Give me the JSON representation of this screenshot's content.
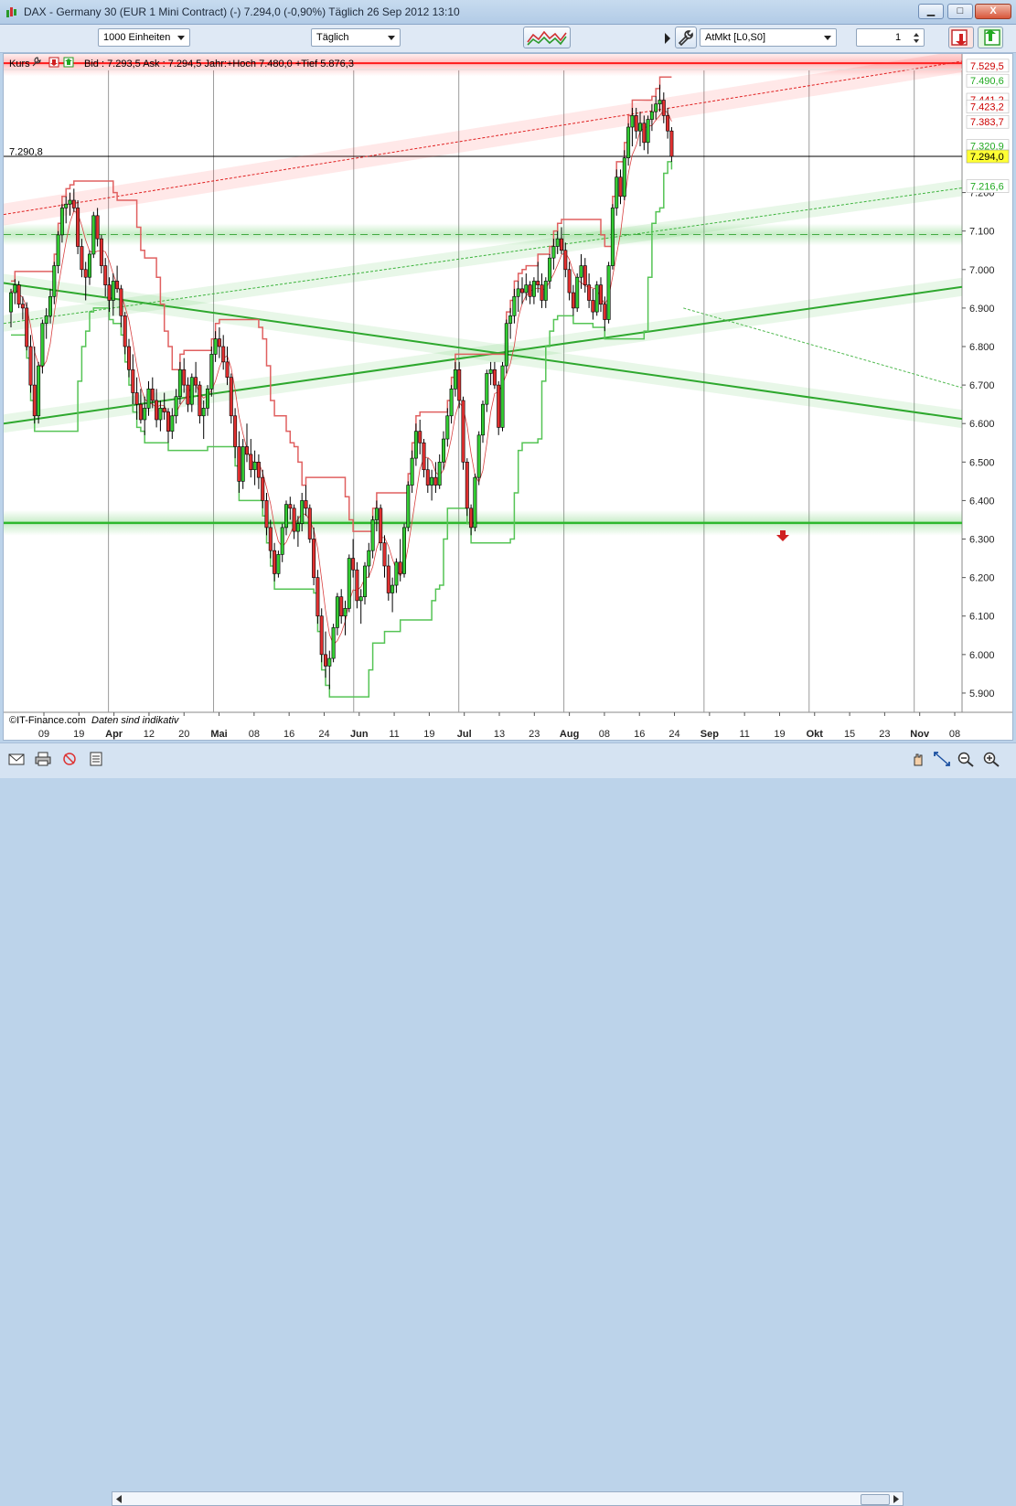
{
  "window": {
    "title": "DAX - Germany 30 (EUR 1 Mini Contract) (-)   7.294,0 (-0,90%)   Täglich  26 Sep 2012 13:10",
    "minimize": "▁",
    "maximize": "□",
    "close": "X"
  },
  "toolbar": {
    "units_select": "1000 Einheiten",
    "interval_select": "Täglich",
    "order_type_select": "AtMkt [L0,S0]",
    "quantity_value": "1"
  },
  "chart_header": {
    "label": "Kurs",
    "bid_ask_text": "Bid : 7.293,5 Ask : 7.294,5 Jahr:+Hoch 7.480,0 +Tief 5.876,3"
  },
  "footer": {
    "copyright": "©IT-Finance.com",
    "disclaimer": "Daten sind indikativ"
  },
  "colors": {
    "up": "#33cc33",
    "down": "#e03030",
    "resistance": "#ff1a1a",
    "support": "#2db82d",
    "price_tag": "#ffff33"
  },
  "chart_data": {
    "type": "candlestick",
    "ylim": [
      5850,
      7560
    ],
    "y_ticks": [
      "5.900",
      "6.000",
      "6.100",
      "6.200",
      "6.300",
      "6.400",
      "6.500",
      "6.600",
      "6.700",
      "6.800",
      "6.900",
      "7.000",
      "7.100",
      "7.200"
    ],
    "x_ticks": [
      "09",
      "19",
      "Apr",
      "12",
      "20",
      "Mai",
      "08",
      "16",
      "24",
      "Jun",
      "11",
      "19",
      "Jul",
      "13",
      "23",
      "Aug",
      "08",
      "16",
      "24",
      "Sep",
      "11",
      "19",
      "Okt",
      "15",
      "23",
      "Nov",
      "08"
    ],
    "month_ticks": [
      "Apr",
      "Mai",
      "Jun",
      "Jul",
      "Aug",
      "Sep",
      "Okt",
      "Nov"
    ],
    "crosshair_value": "7.290,8",
    "price_labels": [
      {
        "text": "7.529,5",
        "value": 7529.5,
        "color": "#cc0000"
      },
      {
        "text": "7.490,6",
        "value": 7490.6,
        "color": "#22aa22"
      },
      {
        "text": "7.441,2",
        "value": 7441.2,
        "color": "#cc0000"
      },
      {
        "text": "7.423,2",
        "value": 7423.2,
        "color": "#cc0000"
      },
      {
        "text": "7.383,7",
        "value": 7383.7,
        "color": "#cc0000"
      },
      {
        "text": "7.320,9",
        "value": 7320.9,
        "color": "#22aa22"
      },
      {
        "text": "7.294,0",
        "value": 7294.0,
        "color": "#000000"
      },
      {
        "text": "7.216,6",
        "value": 7216.6,
        "color": "#22aa22"
      }
    ],
    "horizontal_levels": [
      {
        "value": 7536,
        "style": "resistance"
      },
      {
        "value": 7294,
        "style": "price"
      },
      {
        "value": 7091,
        "style": "dashed-support"
      },
      {
        "value": 6342,
        "style": "support"
      }
    ],
    "trend_lines": [
      {
        "from": [
          0,
          7143
        ],
        "to": [
          254,
          7541
        ],
        "style": "dotted-red"
      },
      {
        "from": [
          0,
          6600
        ],
        "to": [
          254,
          6955
        ],
        "style": "support"
      },
      {
        "from": [
          0,
          6965
        ],
        "to": [
          254,
          6612
        ],
        "style": "support"
      },
      {
        "from": [
          0,
          6860
        ],
        "to": [
          254,
          7212
        ],
        "style": "dotted-green"
      },
      {
        "from": [
          171,
          6900
        ],
        "to": [
          254,
          6693
        ],
        "style": "dotted-green-thin"
      }
    ],
    "candles": [
      {
        "o": 6890,
        "h": 6950,
        "l": 6850,
        "c": 6940
      },
      {
        "o": 6940,
        "h": 6975,
        "l": 6910,
        "c": 6960
      },
      {
        "o": 6960,
        "h": 6970,
        "l": 6900,
        "c": 6910
      },
      {
        "o": 6910,
        "h": 6930,
        "l": 6870,
        "c": 6900
      },
      {
        "o": 6900,
        "h": 6915,
        "l": 6790,
        "c": 6800
      },
      {
        "o": 6800,
        "h": 6830,
        "l": 6680,
        "c": 6700
      },
      {
        "o": 6700,
        "h": 6800,
        "l": 6600,
        "c": 6620
      },
      {
        "o": 6620,
        "h": 6760,
        "l": 6600,
        "c": 6750
      },
      {
        "o": 6750,
        "h": 6870,
        "l": 6730,
        "c": 6860
      },
      {
        "o": 6860,
        "h": 6900,
        "l": 6820,
        "c": 6880
      },
      {
        "o": 6880,
        "h": 6950,
        "l": 6860,
        "c": 6930
      },
      {
        "o": 6930,
        "h": 7020,
        "l": 6910,
        "c": 7010
      },
      {
        "o": 7010,
        "h": 7100,
        "l": 6990,
        "c": 7090
      },
      {
        "o": 7090,
        "h": 7170,
        "l": 7070,
        "c": 7160
      },
      {
        "o": 7160,
        "h": 7190,
        "l": 7120,
        "c": 7170
      },
      {
        "o": 7170,
        "h": 7200,
        "l": 7140,
        "c": 7180
      },
      {
        "o": 7180,
        "h": 7210,
        "l": 7150,
        "c": 7160
      },
      {
        "o": 7160,
        "h": 7180,
        "l": 7040,
        "c": 7060
      },
      {
        "o": 7060,
        "h": 7080,
        "l": 6980,
        "c": 7000
      },
      {
        "o": 7000,
        "h": 7020,
        "l": 6920,
        "c": 6980
      },
      {
        "o": 6980,
        "h": 7050,
        "l": 6960,
        "c": 7040
      },
      {
        "o": 7040,
        "h": 7150,
        "l": 7030,
        "c": 7140
      },
      {
        "o": 7140,
        "h": 7160,
        "l": 7060,
        "c": 7080
      },
      {
        "o": 7080,
        "h": 7090,
        "l": 6990,
        "c": 7010
      },
      {
        "o": 7010,
        "h": 7030,
        "l": 6930,
        "c": 6960
      },
      {
        "o": 6960,
        "h": 6980,
        "l": 6890,
        "c": 6920
      },
      {
        "o": 6920,
        "h": 6990,
        "l": 6880,
        "c": 6970
      },
      {
        "o": 6970,
        "h": 7010,
        "l": 6940,
        "c": 6950
      },
      {
        "o": 6950,
        "h": 6960,
        "l": 6850,
        "c": 6880
      },
      {
        "o": 6880,
        "h": 6890,
        "l": 6780,
        "c": 6800
      },
      {
        "o": 6800,
        "h": 6820,
        "l": 6720,
        "c": 6740
      },
      {
        "o": 6740,
        "h": 6780,
        "l": 6650,
        "c": 6680
      },
      {
        "o": 6680,
        "h": 6720,
        "l": 6610,
        "c": 6650
      },
      {
        "o": 6650,
        "h": 6690,
        "l": 6600,
        "c": 6610
      },
      {
        "o": 6610,
        "h": 6670,
        "l": 6570,
        "c": 6640
      },
      {
        "o": 6640,
        "h": 6710,
        "l": 6620,
        "c": 6690
      },
      {
        "o": 6690,
        "h": 6720,
        "l": 6640,
        "c": 6660
      },
      {
        "o": 6660,
        "h": 6690,
        "l": 6590,
        "c": 6610
      },
      {
        "o": 6610,
        "h": 6660,
        "l": 6580,
        "c": 6640
      },
      {
        "o": 6640,
        "h": 6680,
        "l": 6610,
        "c": 6630
      },
      {
        "o": 6630,
        "h": 6640,
        "l": 6550,
        "c": 6580
      },
      {
        "o": 6580,
        "h": 6640,
        "l": 6560,
        "c": 6620
      },
      {
        "o": 6620,
        "h": 6690,
        "l": 6600,
        "c": 6670
      },
      {
        "o": 6670,
        "h": 6760,
        "l": 6650,
        "c": 6740
      },
      {
        "o": 6740,
        "h": 6770,
        "l": 6680,
        "c": 6700
      },
      {
        "o": 6700,
        "h": 6720,
        "l": 6630,
        "c": 6650
      },
      {
        "o": 6650,
        "h": 6730,
        "l": 6630,
        "c": 6720
      },
      {
        "o": 6720,
        "h": 6760,
        "l": 6680,
        "c": 6700
      },
      {
        "o": 6700,
        "h": 6710,
        "l": 6600,
        "c": 6620
      },
      {
        "o": 6620,
        "h": 6660,
        "l": 6560,
        "c": 6640
      },
      {
        "o": 6640,
        "h": 6700,
        "l": 6620,
        "c": 6690
      },
      {
        "o": 6690,
        "h": 6800,
        "l": 6670,
        "c": 6780
      },
      {
        "o": 6780,
        "h": 6840,
        "l": 6760,
        "c": 6820
      },
      {
        "o": 6820,
        "h": 6850,
        "l": 6770,
        "c": 6800
      },
      {
        "o": 6800,
        "h": 6830,
        "l": 6740,
        "c": 6760
      },
      {
        "o": 6760,
        "h": 6800,
        "l": 6700,
        "c": 6720
      },
      {
        "o": 6720,
        "h": 6730,
        "l": 6600,
        "c": 6620
      },
      {
        "o": 6620,
        "h": 6640,
        "l": 6510,
        "c": 6540
      },
      {
        "o": 6540,
        "h": 6580,
        "l": 6420,
        "c": 6450
      },
      {
        "o": 6450,
        "h": 6560,
        "l": 6430,
        "c": 6540
      },
      {
        "o": 6540,
        "h": 6600,
        "l": 6500,
        "c": 6520
      },
      {
        "o": 6520,
        "h": 6560,
        "l": 6460,
        "c": 6480
      },
      {
        "o": 6480,
        "h": 6530,
        "l": 6440,
        "c": 6500
      },
      {
        "o": 6500,
        "h": 6520,
        "l": 6430,
        "c": 6460
      },
      {
        "o": 6460,
        "h": 6480,
        "l": 6380,
        "c": 6400
      },
      {
        "o": 6400,
        "h": 6420,
        "l": 6310,
        "c": 6330
      },
      {
        "o": 6330,
        "h": 6350,
        "l": 6250,
        "c": 6270
      },
      {
        "o": 6270,
        "h": 6290,
        "l": 6190,
        "c": 6210
      },
      {
        "o": 6210,
        "h": 6270,
        "l": 6200,
        "c": 6260
      },
      {
        "o": 6260,
        "h": 6340,
        "l": 6240,
        "c": 6330
      },
      {
        "o": 6330,
        "h": 6400,
        "l": 6310,
        "c": 6390
      },
      {
        "o": 6390,
        "h": 6410,
        "l": 6350,
        "c": 6380
      },
      {
        "o": 6380,
        "h": 6390,
        "l": 6300,
        "c": 6320
      },
      {
        "o": 6320,
        "h": 6360,
        "l": 6280,
        "c": 6340
      },
      {
        "o": 6340,
        "h": 6420,
        "l": 6320,
        "c": 6400
      },
      {
        "o": 6400,
        "h": 6440,
        "l": 6360,
        "c": 6380
      },
      {
        "o": 6380,
        "h": 6390,
        "l": 6290,
        "c": 6300
      },
      {
        "o": 6300,
        "h": 6330,
        "l": 6180,
        "c": 6200
      },
      {
        "o": 6200,
        "h": 6220,
        "l": 6080,
        "c": 6100
      },
      {
        "o": 6100,
        "h": 6120,
        "l": 5980,
        "c": 6000
      },
      {
        "o": 6000,
        "h": 6060,
        "l": 5940,
        "c": 5970
      },
      {
        "o": 5970,
        "h": 6010,
        "l": 5910,
        "c": 5990
      },
      {
        "o": 5990,
        "h": 6080,
        "l": 5980,
        "c": 6070
      },
      {
        "o": 6070,
        "h": 6160,
        "l": 6050,
        "c": 6150
      },
      {
        "o": 6150,
        "h": 6170,
        "l": 6080,
        "c": 6100
      },
      {
        "o": 6100,
        "h": 6140,
        "l": 6050,
        "c": 6120
      },
      {
        "o": 6120,
        "h": 6260,
        "l": 6110,
        "c": 6250
      },
      {
        "o": 6250,
        "h": 6300,
        "l": 6200,
        "c": 6220
      },
      {
        "o": 6220,
        "h": 6240,
        "l": 6120,
        "c": 6140
      },
      {
        "o": 6140,
        "h": 6170,
        "l": 6080,
        "c": 6150
      },
      {
        "o": 6150,
        "h": 6240,
        "l": 6130,
        "c": 6230
      },
      {
        "o": 6230,
        "h": 6290,
        "l": 6200,
        "c": 6270
      },
      {
        "o": 6270,
        "h": 6360,
        "l": 6250,
        "c": 6350
      },
      {
        "o": 6350,
        "h": 6400,
        "l": 6320,
        "c": 6380
      },
      {
        "o": 6380,
        "h": 6390,
        "l": 6270,
        "c": 6290
      },
      {
        "o": 6290,
        "h": 6310,
        "l": 6200,
        "c": 6230
      },
      {
        "o": 6230,
        "h": 6260,
        "l": 6140,
        "c": 6160
      },
      {
        "o": 6160,
        "h": 6200,
        "l": 6110,
        "c": 6180
      },
      {
        "o": 6180,
        "h": 6250,
        "l": 6160,
        "c": 6240
      },
      {
        "o": 6240,
        "h": 6300,
        "l": 6190,
        "c": 6210
      },
      {
        "o": 6210,
        "h": 6340,
        "l": 6200,
        "c": 6330
      },
      {
        "o": 6330,
        "h": 6450,
        "l": 6320,
        "c": 6440
      },
      {
        "o": 6440,
        "h": 6530,
        "l": 6420,
        "c": 6510
      },
      {
        "o": 6510,
        "h": 6600,
        "l": 6490,
        "c": 6580
      },
      {
        "o": 6580,
        "h": 6610,
        "l": 6520,
        "c": 6550
      },
      {
        "o": 6550,
        "h": 6560,
        "l": 6460,
        "c": 6480
      },
      {
        "o": 6480,
        "h": 6510,
        "l": 6420,
        "c": 6440
      },
      {
        "o": 6440,
        "h": 6480,
        "l": 6400,
        "c": 6460
      },
      {
        "o": 6460,
        "h": 6500,
        "l": 6420,
        "c": 6440
      },
      {
        "o": 6440,
        "h": 6520,
        "l": 6430,
        "c": 6500
      },
      {
        "o": 6500,
        "h": 6580,
        "l": 6480,
        "c": 6560
      },
      {
        "o": 6560,
        "h": 6640,
        "l": 6540,
        "c": 6620
      },
      {
        "o": 6620,
        "h": 6700,
        "l": 6600,
        "c": 6690
      },
      {
        "o": 6690,
        "h": 6760,
        "l": 6670,
        "c": 6740
      },
      {
        "o": 6740,
        "h": 6760,
        "l": 6640,
        "c": 6660
      },
      {
        "o": 6660,
        "h": 6670,
        "l": 6480,
        "c": 6500
      },
      {
        "o": 6500,
        "h": 6510,
        "l": 6360,
        "c": 6380
      },
      {
        "o": 6380,
        "h": 6390,
        "l": 6310,
        "c": 6330
      },
      {
        "o": 6330,
        "h": 6470,
        "l": 6320,
        "c": 6460
      },
      {
        "o": 6460,
        "h": 6580,
        "l": 6440,
        "c": 6570
      },
      {
        "o": 6570,
        "h": 6660,
        "l": 6550,
        "c": 6650
      },
      {
        "o": 6650,
        "h": 6740,
        "l": 6630,
        "c": 6730
      },
      {
        "o": 6730,
        "h": 6760,
        "l": 6700,
        "c": 6740
      },
      {
        "o": 6740,
        "h": 6760,
        "l": 6690,
        "c": 6700
      },
      {
        "o": 6700,
        "h": 6710,
        "l": 6570,
        "c": 6590
      },
      {
        "o": 6590,
        "h": 6760,
        "l": 6580,
        "c": 6750
      },
      {
        "o": 6750,
        "h": 6870,
        "l": 6730,
        "c": 6860
      },
      {
        "o": 6860,
        "h": 6900,
        "l": 6820,
        "c": 6880
      },
      {
        "o": 6880,
        "h": 6950,
        "l": 6860,
        "c": 6930
      },
      {
        "o": 6930,
        "h": 6970,
        "l": 6890,
        "c": 6950
      },
      {
        "o": 6950,
        "h": 6980,
        "l": 6910,
        "c": 6940
      },
      {
        "o": 6940,
        "h": 6990,
        "l": 6920,
        "c": 6960
      },
      {
        "o": 6960,
        "h": 6970,
        "l": 6910,
        "c": 6930
      },
      {
        "o": 6930,
        "h": 6980,
        "l": 6910,
        "c": 6970
      },
      {
        "o": 6970,
        "h": 7020,
        "l": 6940,
        "c": 6960
      },
      {
        "o": 6960,
        "h": 6990,
        "l": 6900,
        "c": 6920
      },
      {
        "o": 6920,
        "h": 6980,
        "l": 6900,
        "c": 6970
      },
      {
        "o": 6970,
        "h": 7040,
        "l": 6950,
        "c": 7030
      },
      {
        "o": 7030,
        "h": 7080,
        "l": 7000,
        "c": 7060
      },
      {
        "o": 7060,
        "h": 7100,
        "l": 7040,
        "c": 7080
      },
      {
        "o": 7080,
        "h": 7110,
        "l": 7040,
        "c": 7050
      },
      {
        "o": 7050,
        "h": 7070,
        "l": 6980,
        "c": 7000
      },
      {
        "o": 7000,
        "h": 7020,
        "l": 6920,
        "c": 6940
      },
      {
        "o": 6940,
        "h": 6960,
        "l": 6880,
        "c": 6900
      },
      {
        "o": 6900,
        "h": 6990,
        "l": 6890,
        "c": 6980
      },
      {
        "o": 6980,
        "h": 7040,
        "l": 6950,
        "c": 7010
      },
      {
        "o": 7010,
        "h": 7030,
        "l": 6940,
        "c": 6960
      },
      {
        "o": 6960,
        "h": 6990,
        "l": 6900,
        "c": 6920
      },
      {
        "o": 6920,
        "h": 6950,
        "l": 6870,
        "c": 6890
      },
      {
        "o": 6890,
        "h": 6970,
        "l": 6880,
        "c": 6960
      },
      {
        "o": 6960,
        "h": 6980,
        "l": 6890,
        "c": 6910
      },
      {
        "o": 6910,
        "h": 6930,
        "l": 6840,
        "c": 6870
      },
      {
        "o": 6870,
        "h": 7020,
        "l": 6860,
        "c": 7010
      },
      {
        "o": 7010,
        "h": 7170,
        "l": 7000,
        "c": 7160
      },
      {
        "o": 7160,
        "h": 7260,
        "l": 7140,
        "c": 7240
      },
      {
        "o": 7240,
        "h": 7260,
        "l": 7170,
        "c": 7190
      },
      {
        "o": 7190,
        "h": 7310,
        "l": 7180,
        "c": 7290
      },
      {
        "o": 7290,
        "h": 7380,
        "l": 7270,
        "c": 7370
      },
      {
        "o": 7370,
        "h": 7420,
        "l": 7320,
        "c": 7400
      },
      {
        "o": 7400,
        "h": 7420,
        "l": 7340,
        "c": 7360
      },
      {
        "o": 7360,
        "h": 7410,
        "l": 7320,
        "c": 7380
      },
      {
        "o": 7380,
        "h": 7400,
        "l": 7310,
        "c": 7330
      },
      {
        "o": 7330,
        "h": 7400,
        "l": 7300,
        "c": 7390
      },
      {
        "o": 7390,
        "h": 7430,
        "l": 7360,
        "c": 7410
      },
      {
        "o": 7410,
        "h": 7450,
        "l": 7390,
        "c": 7430
      },
      {
        "o": 7430,
        "h": 7480,
        "l": 7410,
        "c": 7440
      },
      {
        "o": 7440,
        "h": 7460,
        "l": 7380,
        "c": 7400
      },
      {
        "o": 7400,
        "h": 7420,
        "l": 7340,
        "c": 7360
      },
      {
        "o": 7360,
        "h": 7370,
        "l": 7280,
        "c": 7294
      }
    ]
  }
}
